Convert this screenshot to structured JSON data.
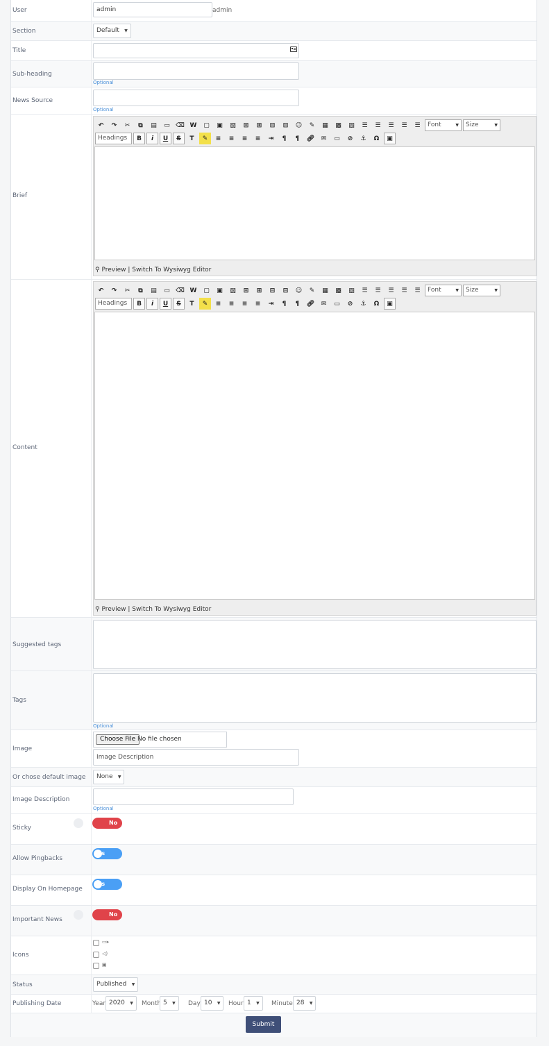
{
  "user": {
    "label": "User",
    "value": "admin",
    "display": "admin"
  },
  "section": {
    "label": "Section",
    "selected": "Default"
  },
  "title": {
    "label": "Title",
    "value": ""
  },
  "subheading": {
    "label": "Sub-heading",
    "value": "",
    "hint": "Optional"
  },
  "news_source": {
    "label": "News Source",
    "value": "",
    "hint": "Optional"
  },
  "brief": {
    "label": "Brief",
    "footer": "Preview | Switch To Wysiwyg Editor"
  },
  "content": {
    "label": "Content",
    "footer": "Preview | Switch To Wysiwyg Editor"
  },
  "editor_toolbar": {
    "font": "Font",
    "size": "Size",
    "headings": "Headings"
  },
  "suggested_tags": {
    "label": "Suggested tags"
  },
  "tags": {
    "label": "Tags",
    "hint": "Optional"
  },
  "image": {
    "label": "Image",
    "choose_file": "Choose File",
    "no_file": "No file chosen",
    "description_placeholder": "Image Description"
  },
  "default_image": {
    "label": "Or chose default image",
    "selected": "None"
  },
  "image_description": {
    "label": "Image Description",
    "hint": "Optional"
  },
  "sticky": {
    "label": "Sticky",
    "state": "No"
  },
  "allow_pingbacks": {
    "label": "Allow Pingbacks",
    "state": "es"
  },
  "display_on_homepage": {
    "label": "Display On Homepage",
    "state": "es"
  },
  "important_news": {
    "label": "Important News",
    "state": "No"
  },
  "icons": {
    "label": "Icons"
  },
  "status": {
    "label": "Status",
    "selected": "Published"
  },
  "publishing_date": {
    "label": "Publishing Date",
    "year_label": "Year",
    "year": "2020",
    "month_label": "Month",
    "month": "5",
    "day_label": "Day",
    "day": "10",
    "hour_label": "Hour",
    "hour": "1",
    "minute_label": "Minute",
    "minute": "28"
  },
  "submit_label": "Submit",
  "colors": {
    "accent": "#3f4f78",
    "toggle_no": "#e0434a",
    "toggle_yes": "#4a9ff5",
    "hint": "#4a90d9"
  }
}
